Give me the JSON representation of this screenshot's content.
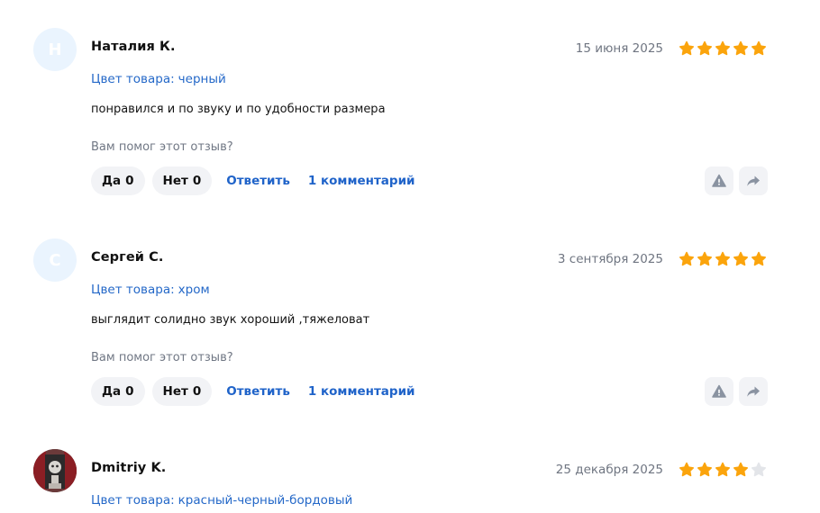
{
  "reviews": [
    {
      "avatar_letter": "Н",
      "author": "Наталия К.",
      "date": "15 июня 2025",
      "rating": 5,
      "attr_label": "Цвет товара:",
      "attr_value": "черный",
      "text": "понравился и по звуку и по удобности размера",
      "helpful_prompt": "Вам помог этот отзыв?",
      "yes_label": "Да",
      "yes_count": "0",
      "no_label": "Нет",
      "no_count": "0",
      "reply_label": "Ответить",
      "comments_label": "1 комментарий"
    },
    {
      "avatar_letter": "С",
      "author": "Сергей С.",
      "date": "3 сентября 2025",
      "rating": 5,
      "attr_label": "Цвет товара:",
      "attr_value": "хром",
      "text": "выглядит солидно звук хороший ,тяжеловат",
      "helpful_prompt": "Вам помог этот отзыв?",
      "yes_label": "Да",
      "yes_count": "0",
      "no_label": "Нет",
      "no_count": "0",
      "reply_label": "Ответить",
      "comments_label": "1 комментарий"
    },
    {
      "author": "Dmitriy K.",
      "date": "25 декабря 2025",
      "rating": 4,
      "attr_label": "Цвет товара:",
      "attr_value": "красный-черный-бордовый"
    }
  ],
  "colors": {
    "star_filled": "#fba40c",
    "star_empty": "#e3e5e9",
    "link": "#1f63c9",
    "icon": "#8a93a1"
  },
  "icons": {
    "complain": "warning-triangle-icon",
    "share": "share-arrow-icon"
  }
}
